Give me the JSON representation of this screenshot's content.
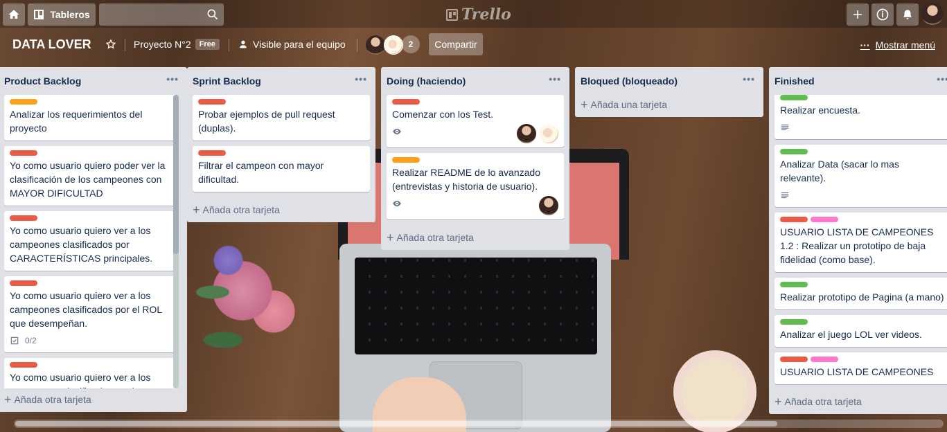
{
  "colors": {
    "label_green": "#61bd4f",
    "label_orange": "#ff9f1a",
    "label_red": "#eb5a46",
    "label_pink": "#ff78cb"
  },
  "header": {
    "home_icon": "house-icon",
    "boards_label": "Tableros",
    "search_value": "",
    "logo_text": "Trello",
    "icons": [
      "plus-icon",
      "info-icon",
      "bell-icon"
    ]
  },
  "board": {
    "title": "DATA LOVER",
    "team": "Proyecto N°2",
    "plan_badge": "Free",
    "visibility": "Visible para el equipo",
    "member_count": "2",
    "share_label": "Compartir",
    "menu_label": "Mostrar menú"
  },
  "lists": [
    {
      "title": "Product Backlog",
      "add_label": "Añada otra tarjeta",
      "cards": [
        {
          "labels": [
            "orange"
          ],
          "title": "Analizar los requerimientos del proyecto"
        },
        {
          "labels": [
            "red"
          ],
          "title": "Yo como usuario quiero poder ver la clasificación de los campeones con MAYOR DIFICULTAD"
        },
        {
          "labels": [
            "red"
          ],
          "title": "Yo como usuario quiero ver a los campeones clasificados por CARACTERÍSTICAS principales."
        },
        {
          "labels": [
            "red"
          ],
          "title": "Yo como usuario quiero ver a los campeones clasificados por el ROL que desempeñan.",
          "checklist": "0/2"
        },
        {
          "labels": [
            "red"
          ],
          "title": "Yo como usuario quiero ver a los campeones clasificados por los"
        }
      ]
    },
    {
      "title": "Sprint Backlog",
      "add_label": "Añada otra tarjeta",
      "cards": [
        {
          "labels": [
            "red"
          ],
          "title": "Probar ejemplos de pull request (duplas)."
        },
        {
          "labels": [
            "red"
          ],
          "title": "Filtrar el campeon con mayor dificultad."
        }
      ]
    },
    {
      "title": "Doing (haciendo)",
      "add_label": "Añada otra tarjeta",
      "cards": [
        {
          "labels": [
            "red"
          ],
          "title": "Comenzar con los Test."
        },
        {
          "labels": [
            "orange"
          ],
          "title": "Realizar README de lo avanzado (entrevistas y historia de usuario)."
        }
      ]
    },
    {
      "title": "Bloqued (bloqueado)",
      "add_label": "Añada una tarjeta",
      "cards": []
    },
    {
      "title": "Finished",
      "add_label": "Añada otra tarjeta",
      "cards": [
        {
          "labels": [
            "green"
          ],
          "title": "Realizar encuesta."
        },
        {
          "labels": [
            "green"
          ],
          "title": "Analizar Data (sacar lo mas relevante)."
        },
        {
          "labels": [
            "red",
            "pink"
          ],
          "title": "USUARIO LISTA DE CAMPEONES 1.2 : Realizar un prototipo de baja fidelidad (como base)."
        },
        {
          "labels": [
            "green"
          ],
          "title": "Realizar prototipo de Pagina (a mano)"
        },
        {
          "labels": [
            "green"
          ],
          "title": "Analizar el juego LOL ver videos."
        },
        {
          "labels": [
            "red",
            "pink"
          ],
          "title": "USUARIO LISTA DE CAMPEONES"
        }
      ]
    }
  ]
}
